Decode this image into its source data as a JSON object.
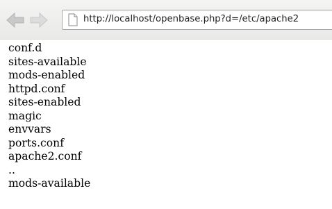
{
  "browser": {
    "address_bar": {
      "url": "http://localhost/openbase.php?d=/etc/apache2"
    },
    "icons": {
      "back": "back-arrow-icon",
      "forward": "forward-arrow-icon",
      "page": "page-icon"
    }
  },
  "directory_listing": {
    "entries": [
      "conf.d",
      "sites-available",
      "mods-enabled",
      "httpd.conf",
      "sites-enabled",
      "magic",
      "envvars",
      "ports.conf",
      "apache2.conf",
      "..",
      "mods-available"
    ]
  }
}
